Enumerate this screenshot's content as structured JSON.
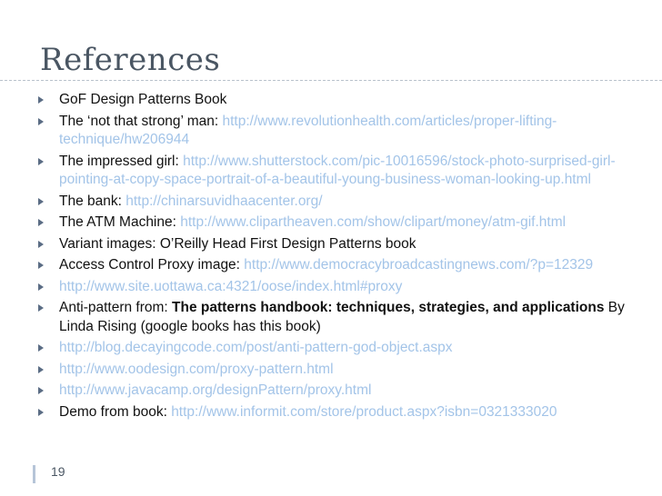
{
  "slide": {
    "title": "References",
    "page_number": "19"
  },
  "colors": {
    "title": "#4a5663",
    "link": "#a3c4e8",
    "bullet": "#5a6c84"
  },
  "bullet_icon": "triangle-right-icon",
  "items": [
    {
      "text": "GoF Design Patterns Book"
    },
    {
      "prefix": "The ‘not that strong’ man:",
      "link": " http://www.revolutionhealth.com/articles/proper-lifting-technique/hw206944"
    },
    {
      "prefix": "The impressed girl: ",
      "link": "http://www.shutterstock.com/pic-10016596/stock-photo-surprised-girl-pointing-at-copy-space-portrait-of-a-beautiful-young-business-woman-looking-up.html"
    },
    {
      "prefix": "The bank: ",
      "link": "http://chinarsuvidhaacenter.org/"
    },
    {
      "prefix": "The ATM Machine: ",
      "link": "http://www.clipartheaven.com/show/clipart/money/atm-gif.html"
    },
    {
      "text": "Variant images: O’Reilly Head First Design Patterns book"
    },
    {
      "prefix": "Access Control Proxy image: ",
      "link": "http://www.democracybroadcastingnews.com/?p=12329"
    },
    {
      "link": "http://www.site.uottawa.ca:4321/oose/index.html#proxy"
    },
    {
      "prefix": "Anti-pattern from: ",
      "bold": "The patterns handbook: techniques, strategies, and applications",
      "suffix": " By Linda Rising (google books has this book)"
    },
    {
      "link": "http://blog.decayingcode.com/post/anti-pattern-god-object.aspx"
    },
    {
      "link": "http://www.oodesign.com/proxy-pattern.html"
    },
    {
      "link": "http://www.javacamp.org/designPattern/proxy.html"
    },
    {
      "prefix": "Demo from book: ",
      "link": "http://www.informit.com/store/product.aspx?isbn=0321333020"
    }
  ]
}
